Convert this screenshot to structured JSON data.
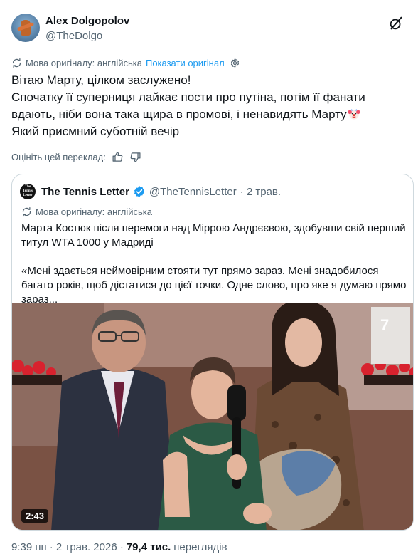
{
  "author": {
    "name": "Alex Dolgopolov",
    "handle": "@TheDolgo"
  },
  "translation": {
    "original_language": "Мова оригіналу: англійська",
    "show_original": "Показати оригінал"
  },
  "tweet": {
    "line1": "Вітаю Марту, цілком заслужено!",
    "line2": "Спочатку її суперниця лайкає пости про путіна, потім її фанати вдають, ніби вона така щира в промові, і ненавидять Марту",
    "line3": "Який приємний суботній вечір",
    "emoji": "clown-face"
  },
  "rate": {
    "label": "Оцініть цей переклад:"
  },
  "quote": {
    "name": "The Tennis Letter",
    "handle": "@TheTennisLetter",
    "time": "· 2 трав.",
    "avatar_text": "The Tennis Letter",
    "original_language": "Мова оригіналу: англійська",
    "text1": "Марта Костюк після перемоги над Міррою Андрєєвою, здобувши свій перший титул WTA 1000 у Мадриді",
    "text2": "«Мені здається неймовірним стояти тут прямо зараз. Мені знадобилося багато років, щоб дістатися до цієї точки. Одне слово, про яке я думаю прямо зараз...",
    "video_duration": "2:43"
  },
  "meta": {
    "time": "9:39 пп · 2 трав. 2026 ·",
    "views_count": "79,4 тис.",
    "views_label": "переглядів"
  },
  "colors": {
    "accent": "#1d9bf0",
    "secondary_text": "#536471",
    "border": "#cfd9de"
  }
}
